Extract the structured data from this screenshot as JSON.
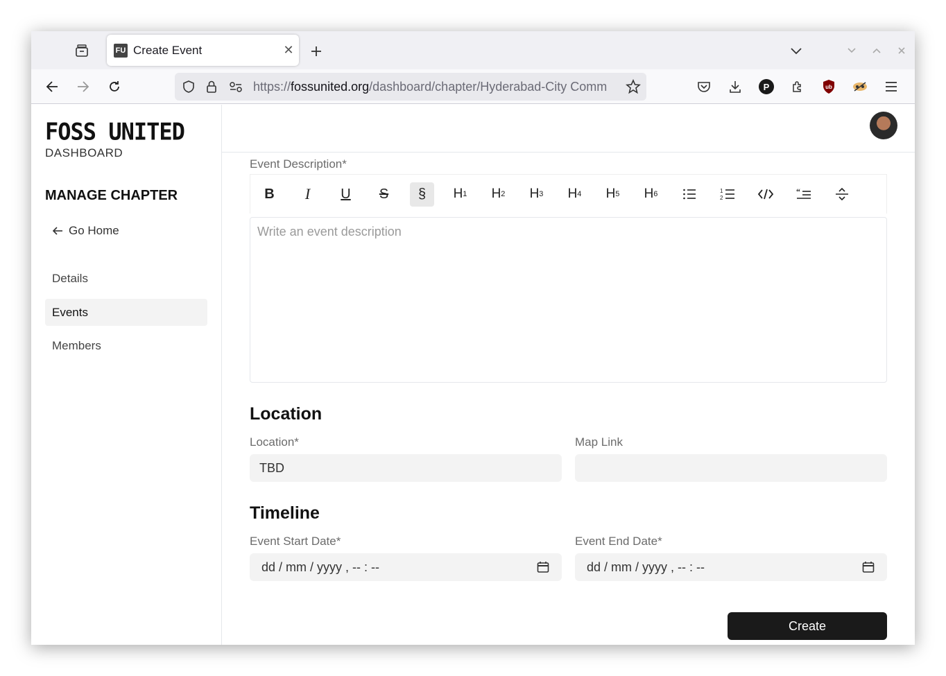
{
  "browser": {
    "tab": {
      "favicon": "FU",
      "title": "Create Event"
    },
    "url": {
      "prefix": "https://",
      "host": "fossunited.org",
      "path": "/dashboard/chapter/Hyderabad-City Comm"
    }
  },
  "sidebar": {
    "logo": "FOSS UNITED",
    "logo_sub": "DASHBOARD",
    "heading": "MANAGE CHAPTER",
    "go_home": "Go Home",
    "items": [
      {
        "label": "Details",
        "active": false
      },
      {
        "label": "Events",
        "active": true
      },
      {
        "label": "Members",
        "active": false
      }
    ]
  },
  "form": {
    "description_label": "Event Description*",
    "toolbar": [
      "B",
      "I",
      "U",
      "S",
      "§",
      "H1",
      "H2",
      "H3",
      "H4",
      "H5",
      "H6",
      "bullet-list",
      "ordered-list",
      "code",
      "blockquote",
      "horizontal-rule"
    ],
    "description_placeholder": "Write an event description",
    "location_section": "Location",
    "location_label": "Location*",
    "location_value": "TBD",
    "map_link_label": "Map Link",
    "map_link_value": "",
    "timeline_section": "Timeline",
    "start_label": "Event Start Date*",
    "start_placeholder": "dd / mm / yyyy ,  -- : --",
    "end_label": "Event End Date*",
    "end_placeholder": "dd / mm / yyyy ,  -- : --",
    "create_button": "Create"
  }
}
